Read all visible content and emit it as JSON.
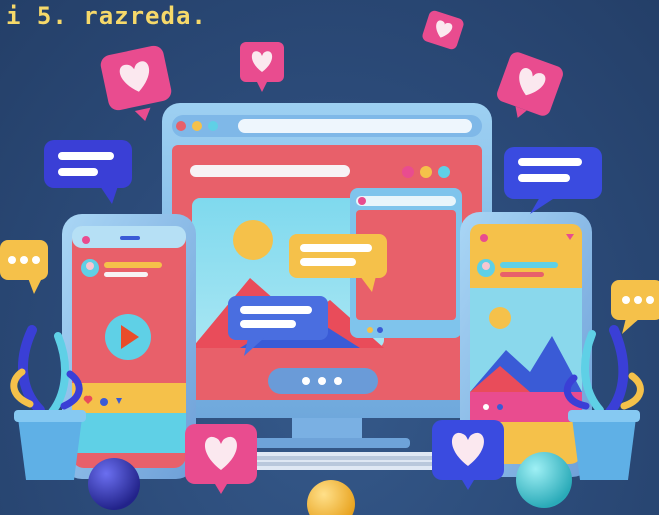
{
  "caption": {
    "text": "i 5. razreda."
  },
  "icons": {
    "heart": "heart-icon",
    "chat": "chat-bubble-icon",
    "play": "play-icon",
    "image": "image-icon",
    "profile": "profile-icon",
    "plant": "plant-icon",
    "sphere": "sphere-icon"
  },
  "colors": {
    "background": "#2b4a78",
    "caption": "#f6d96a",
    "pink": "#e94c8f",
    "coral": "#e8606a",
    "yellow": "#f5c14a",
    "cyan": "#5fd0e6",
    "blue": "#3a5bd6",
    "monitor_frame": "#8ec5ee"
  }
}
